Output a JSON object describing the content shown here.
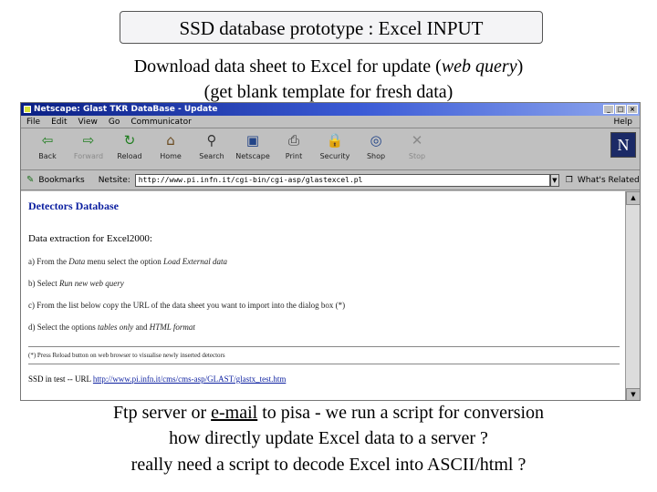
{
  "slide": {
    "title": "SSD database prototype : Excel INPUT",
    "line1_pre": "Download data sheet to Excel for update (",
    "line1_em": "web query",
    "line1_post": ")",
    "line2": "(get blank template for fresh data)",
    "bottom1_pre": "Ftp server or ",
    "bottom1_link": "e-mail",
    "bottom1_post": " to pisa - we run a script for conversion",
    "bottom2": "how directly update Excel data to a server ?",
    "bottom3": "really need a script to decode Excel into ASCII/html ?"
  },
  "browser": {
    "title": "Netscape: Glast TKR DataBase - Update",
    "menu": [
      "File",
      "Edit",
      "View",
      "Go",
      "Communicator"
    ],
    "menu_help": "Help",
    "toolbar": [
      {
        "label": "Back",
        "icon": "back-arrow-icon",
        "glyph": "⇦",
        "color": "#1e7d1e",
        "disabled": false
      },
      {
        "label": "Forward",
        "icon": "forward-arrow-icon",
        "glyph": "⇨",
        "color": "#1e7d1e",
        "disabled": true
      },
      {
        "label": "Reload",
        "icon": "reload-icon",
        "glyph": "↻",
        "color": "#1e7d1e",
        "disabled": false
      },
      {
        "label": "Home",
        "icon": "home-icon",
        "glyph": "⌂",
        "color": "#6a4a1e",
        "disabled": false
      },
      {
        "label": "Search",
        "icon": "search-icon",
        "glyph": "⚲",
        "color": "#333333",
        "disabled": false
      },
      {
        "label": "Netscape",
        "icon": "netscape-icon",
        "glyph": "▣",
        "color": "#224488",
        "disabled": false
      },
      {
        "label": "Print",
        "icon": "print-icon",
        "glyph": "⎙",
        "color": "#333333",
        "disabled": false
      },
      {
        "label": "Security",
        "icon": "security-lock-icon",
        "glyph": "🔒",
        "color": "#b08a1e",
        "disabled": false
      },
      {
        "label": "Shop",
        "icon": "shop-icon",
        "glyph": "◎",
        "color": "#224488",
        "disabled": false
      },
      {
        "label": "Stop",
        "icon": "stop-icon",
        "glyph": "✕",
        "color": "#8a8a8a",
        "disabled": true
      }
    ],
    "bookmarks_label": "Bookmarks",
    "location_label": "Netsite:",
    "location_url": "http://www.pi.infn.it/cgi-bin/cgi-asp/glastexcel.pl",
    "whats_related": "What's Related",
    "logo": "N"
  },
  "page": {
    "db_title": "Detectors Database",
    "section": "Data extraction for Excel2000:",
    "step_a_pre": "a) From the ",
    "step_a_em1": "Data",
    "step_a_mid": " menu select the option ",
    "step_a_em2": "Load External data",
    "step_b_pre": "b) Select ",
    "step_b_em": "Run new web query",
    "step_c": "c) From the list below copy the URL of the data sheet you want to import into the dialog box (*)",
    "step_d_pre": "d) Select the options ",
    "step_d_em1": "tables only",
    "step_d_mid": " and ",
    "step_d_em2": "HTML format",
    "note": "(*) Press Reload button on web browser to visualise newly inserted detectors",
    "ssd_label": "SSD in test -- URL ",
    "ssd_url": "http://www.pi.infn.it/cms/cms-asp/GLAST/glastx_test.htm"
  }
}
